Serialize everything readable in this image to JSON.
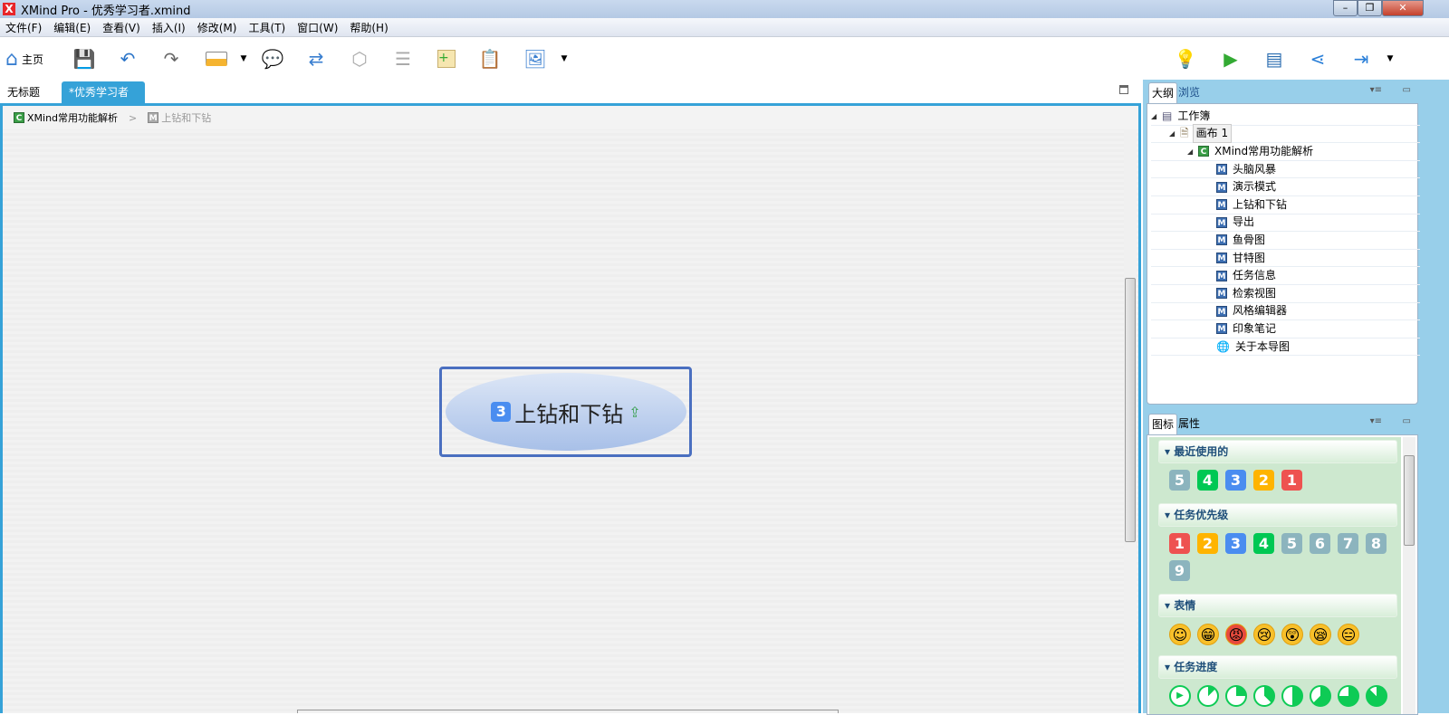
{
  "window": {
    "title": "XMind Pro - 优秀学习者.xmind",
    "logo": "X",
    "minimize": "–",
    "restore": "❐",
    "close": "✕"
  },
  "menu": [
    "文件(F)",
    "编辑(E)",
    "查看(V)",
    "插入(I)",
    "修改(M)",
    "工具(T)",
    "窗口(W)",
    "帮助(H)"
  ],
  "toolbar": {
    "home_label": "主页"
  },
  "tabs": [
    {
      "label": "无标题"
    },
    {
      "label": "*优秀学习者",
      "close": "✕"
    }
  ],
  "breadcrumb": [
    {
      "icon": "C",
      "label": "XMind常用功能解析"
    },
    {
      "icon": "M",
      "label": "上钻和下钻"
    }
  ],
  "breadcrumb_sep": ">",
  "central_topic": {
    "number": "3",
    "label": "上钻和下钻"
  },
  "outline": {
    "tabs": [
      "大纲",
      "浏览"
    ],
    "workbook": "工作簿",
    "canvas": "画布 1",
    "root": "XMind常用功能解析",
    "items": [
      "头脑风暴",
      "演示模式",
      "上钻和下钻",
      "导出",
      "鱼骨图",
      "甘特图",
      "任务信息",
      "检索视图",
      "风格编辑器",
      "印象笔记",
      "关于本导图"
    ]
  },
  "icons_panel": {
    "tabs": [
      "图标",
      "属性"
    ],
    "recent": {
      "title": "最近使用的",
      "items": [
        "5",
        "4",
        "3",
        "2",
        "1"
      ]
    },
    "priority": {
      "title": "任务优先级",
      "items": [
        "1",
        "2",
        "3",
        "4",
        "5",
        "6",
        "7",
        "8",
        "9"
      ]
    },
    "emotion": {
      "title": "表情",
      "items": [
        "smile",
        "grin",
        "angry",
        "cry",
        "surprise",
        "sleepy",
        "neutral"
      ]
    },
    "progress": {
      "title": "任务进度",
      "items": [
        0,
        0.125,
        0.25,
        0.375,
        0.5,
        0.625,
        0.75,
        0.875
      ]
    }
  },
  "colors": {
    "1": "#ee5250",
    "2": "#ffb400",
    "3": "#4a8df0",
    "4": "#00c853",
    "other": "#8cb4be",
    "accent": "#35a2d8"
  }
}
